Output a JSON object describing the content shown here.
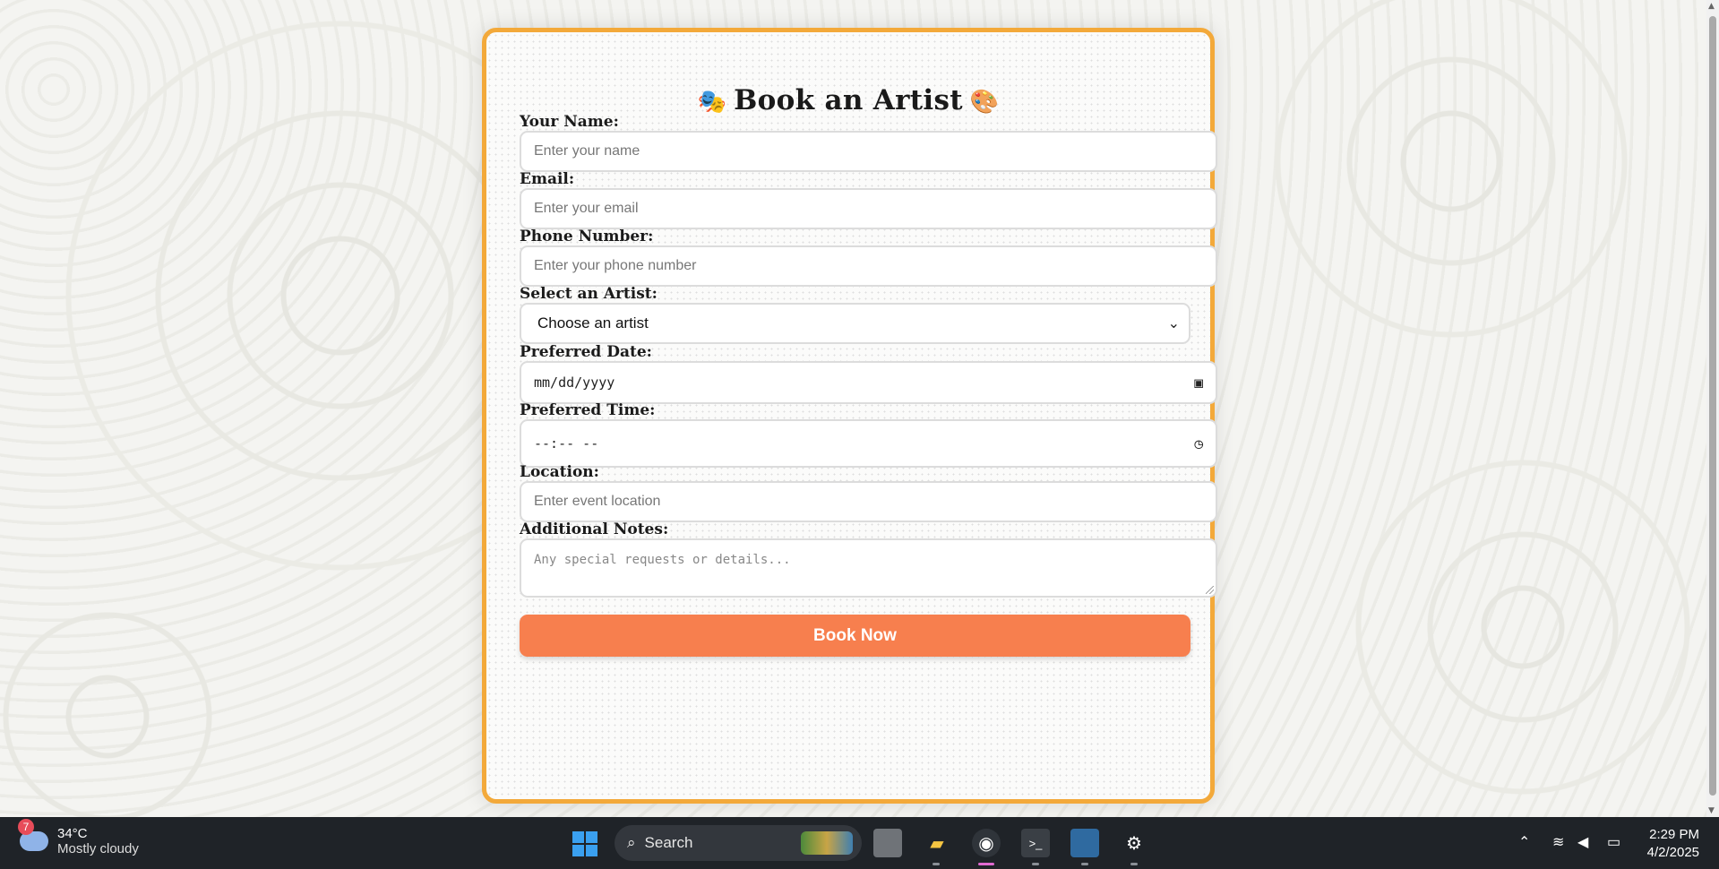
{
  "form": {
    "title": "Book an Artist",
    "title_emoji_left": "🎭",
    "title_emoji_right": "🎨",
    "fields": {
      "name": {
        "label": "Your Name:",
        "placeholder": "Enter your name"
      },
      "email": {
        "label": "Email:",
        "placeholder": "Enter your email"
      },
      "phone": {
        "label": "Phone Number:",
        "placeholder": "Enter your phone number"
      },
      "artist": {
        "label": "Select an Artist:",
        "selected": "Choose an artist"
      },
      "date": {
        "label": "Preferred Date:",
        "value": "mm/dd/yyyy"
      },
      "time": {
        "label": "Preferred Time:",
        "value": "--:-- --"
      },
      "location": {
        "label": "Location:",
        "placeholder": "Enter event location"
      },
      "notes": {
        "label": "Additional Notes:",
        "placeholder": "Any special requests or details..."
      }
    },
    "submit_label": "Book Now",
    "colors": {
      "border": "#f3a93a",
      "button": "#f77f4e"
    }
  },
  "taskbar": {
    "weather": {
      "badge": "7",
      "temp": "34°C",
      "condition": "Mostly cloudy"
    },
    "search_label": "Search",
    "clock": {
      "time": "2:29 PM",
      "date": "4/2/2025"
    }
  }
}
